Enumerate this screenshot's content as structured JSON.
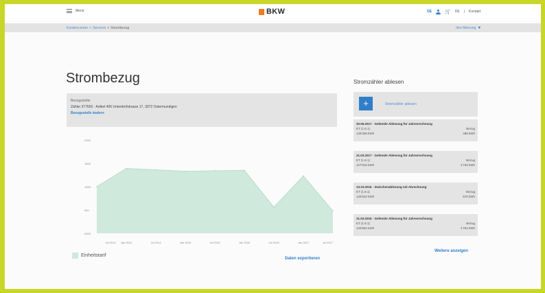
{
  "header": {
    "menu_label": "Menü",
    "logo_text": "BKW",
    "lang_active": "DE",
    "lang_other": "DE",
    "contact": "Kontakt",
    "separator": "|"
  },
  "breadcrumb": {
    "items": [
      "Kundencenter",
      "Services",
      "Strombezug"
    ],
    "separators": [
      ">",
      ">"
    ],
    "feedback": "Ihre Meinung"
  },
  "page": {
    "title": "Strombezug",
    "info": {
      "label": "Bezugsstelle",
      "value": "Zähler 377650 · Artikel 406 Unterdorfstrasse 17, 3072 Ostermundigen",
      "link": "Bezugsstelle ändern"
    },
    "legend_label": "Einheitstarif",
    "export_link": "Daten exportieren"
  },
  "chart_data": {
    "type": "area",
    "x": [
      "Jul 2012",
      "Jan 2014",
      "Jul 2014",
      "Jan 2015",
      "Jul 2015",
      "Jan 2016",
      "Jul 2016",
      "Jan 2017",
      "Jul 2017"
    ],
    "series": [
      {
        "values": [
          1000,
          1390,
          1360,
          1330,
          1340,
          1350,
          560,
          1230,
          480
        ]
      }
    ],
    "y_ticks": [
      "2000",
      "1500",
      "1000",
      "500",
      "0000"
    ],
    "ylim": [
      0,
      2000
    ],
    "color": "#cfe9dc",
    "grid": false
  },
  "sidebar": {
    "title": "Stromzähler ablesen",
    "read_action": "Stromzähler ablesen",
    "plus": "+",
    "readings": [
      {
        "title": "30.06.2017 · Geltende Ablesung für Jahresrechnung",
        "tariff": "ET (1.8.1)",
        "type": "Bezug",
        "meter": "128'308 kWh",
        "consumption": "488 kWh"
      },
      {
        "title": "31.03.2017 · Geltende Ablesung für Jahresrechnung",
        "tariff": "ET (1.8.1)",
        "type": "Bezug",
        "meter": "127'815 kWh",
        "consumption": "1'725 kWh"
      },
      {
        "title": "13.10.2016 · Zwischenablesung mit Abrechnung",
        "tariff": "ET (1.8.1)",
        "type": "Bezug",
        "meter": "126'532 kWh",
        "consumption": "570 kWh"
      },
      {
        "title": "31.03.2016 · Geltende Ablesung für Jahresrechnung",
        "tariff": "ET (1.8.1)",
        "type": "Bezug",
        "meter": "125'962 kWh",
        "consumption": "1'762 kWh"
      }
    ],
    "more_link": "Weitere anzeigen"
  },
  "colors": {
    "accent": "#2f7fc8",
    "brand_orange": "#f07d1e",
    "area_fill": "#cfe9dc",
    "frame_border": "#c8d62a"
  }
}
